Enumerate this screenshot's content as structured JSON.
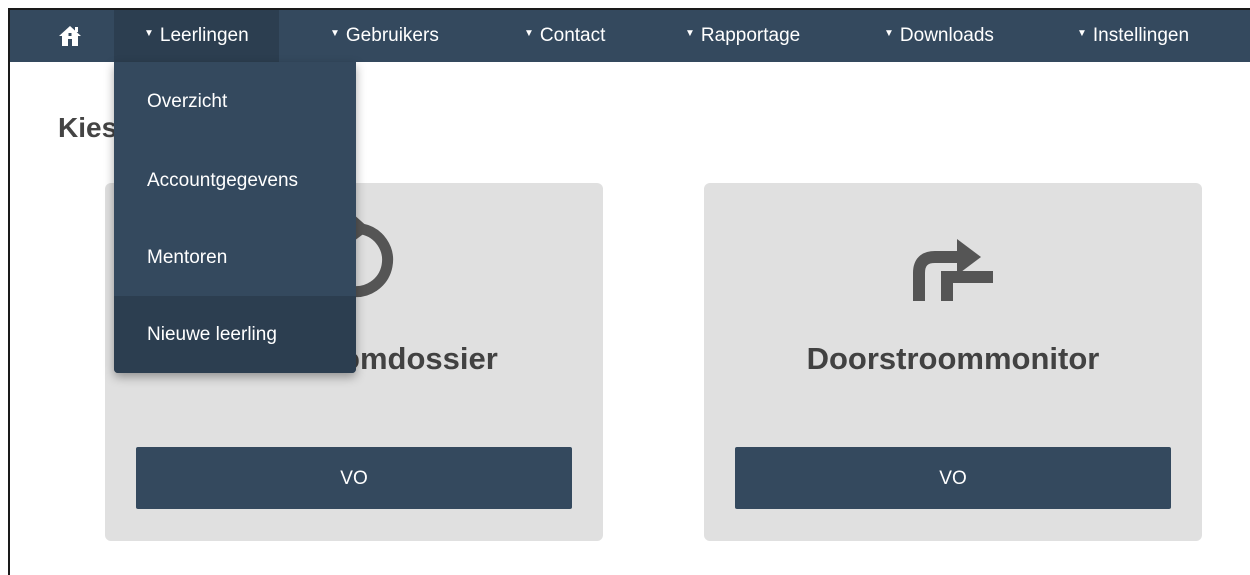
{
  "nav": {
    "home_icon": "home-icon",
    "items": [
      {
        "label": "Leerlingen"
      },
      {
        "label": "Gebruikers"
      },
      {
        "label": "Contact"
      },
      {
        "label": "Rapportage"
      },
      {
        "label": "Downloads"
      },
      {
        "label": "Instellingen"
      }
    ],
    "open_item": "Leerlingen"
  },
  "dropdown": {
    "items": [
      {
        "label": "Overzicht"
      },
      {
        "label": "Accountgegevens"
      },
      {
        "label": "Mentoren"
      },
      {
        "label": "Nieuwe leerling"
      }
    ],
    "highlighted": "Nieuwe leerling"
  },
  "page": {
    "title": "Kies"
  },
  "cards": [
    {
      "icon": "refresh-icon",
      "title": "Doorstroomdossier",
      "button_label": "VO"
    },
    {
      "icon": "step-arrow-icon",
      "title": "Doorstroommonitor",
      "button_label": "VO"
    }
  ],
  "colors": {
    "navbar": "#34495e",
    "navbar_active": "#2c3e50",
    "card_background": "#e0e0e0",
    "icon": "#555555"
  }
}
